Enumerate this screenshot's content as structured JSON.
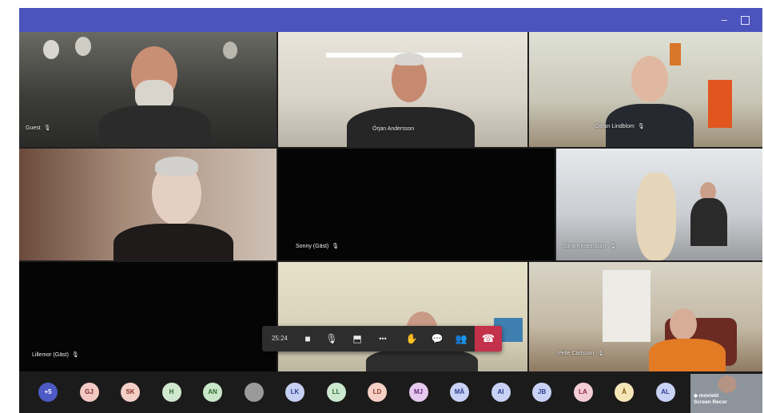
{
  "window": {
    "minimize": "–",
    "maximize": ""
  },
  "tiles": [
    {
      "name": "Guest",
      "mic": "🎙"
    },
    {
      "name": "Örjan Andersson",
      "mic": ""
    },
    {
      "name": "Göran Lindblom",
      "mic": "🎙"
    },
    {
      "name": "",
      "mic": ""
    },
    {
      "name": "Sonny (Gäst)",
      "mic": "🎙"
    },
    {
      "name": "Stina Kristensson",
      "mic": "🎙"
    },
    {
      "name": "Lillemor (Gäst)",
      "mic": "🎙"
    },
    {
      "name": "",
      "mic": ""
    },
    {
      "name": "Pelle Carlsson",
      "mic": "🎙"
    }
  ],
  "controls": {
    "timer": "25:24",
    "camera": "■",
    "mic": "🎙",
    "share": "⬒",
    "more": "•••",
    "raise_hand": "✋",
    "chat": "💬",
    "participants": "👥",
    "hangup": "☎"
  },
  "participants_bar": [
    {
      "initials": "+5",
      "bg": "#4f5bc4",
      "fg": "#ffffff"
    },
    {
      "initials": "GJ",
      "bg": "#f2c9c3",
      "fg": "#7a2b22"
    },
    {
      "initials": "SK",
      "bg": "#f3cfc7",
      "fg": "#8a3325"
    },
    {
      "initials": "H",
      "bg": "#cfe8cf",
      "fg": "#2e6a2e"
    },
    {
      "initials": "AN",
      "bg": "#c9e6c9",
      "fg": "#2e6a2e"
    },
    {
      "initials": "",
      "bg": "#9a9a9a",
      "fg": "#ffffff"
    },
    {
      "initials": "LK",
      "bg": "#c6d0f3",
      "fg": "#2e3d8f"
    },
    {
      "initials": "LL",
      "bg": "#cce9d0",
      "fg": "#2e6a3a"
    },
    {
      "initials": "LD",
      "bg": "#f6d0c6",
      "fg": "#8f3a25"
    },
    {
      "initials": "MJ",
      "bg": "#e6c9ef",
      "fg": "#6a2a80"
    },
    {
      "initials": "MÅ",
      "bg": "#c9d2f5",
      "fg": "#2e3d8f"
    },
    {
      "initials": "AI",
      "bg": "#c9d2f5",
      "fg": "#2e3d8f"
    },
    {
      "initials": "JB",
      "bg": "#c9d2f5",
      "fg": "#2e3d8f"
    },
    {
      "initials": "LA",
      "bg": "#f3cdd5",
      "fg": "#8a2a40"
    },
    {
      "initials": "Å",
      "bg": "#f5e6b8",
      "fg": "#7a5a10"
    },
    {
      "initials": "AL",
      "bg": "#c9d2f5",
      "fg": "#2e3d8f"
    }
  ],
  "self_view": {
    "line1": "◆ moviebl",
    "line2": "Screen Recor"
  }
}
